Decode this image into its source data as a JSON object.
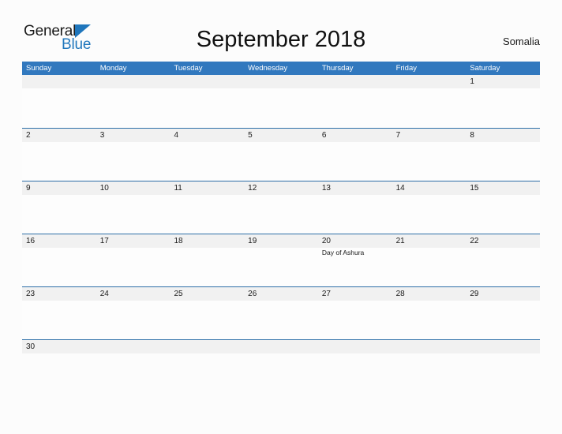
{
  "brand": {
    "name_part1": "General",
    "name_part2": "Blue",
    "triangle_color": "#1F76BC",
    "text_color_part1": "#1a1a1a",
    "text_color_part2": "#1F76BC"
  },
  "header": {
    "title": "September 2018",
    "month": "September",
    "year": "2018",
    "region": "Somalia"
  },
  "theme": {
    "header_bar_color": "#3178BE",
    "row_divider_color": "#2E6FA8",
    "date_band_color": "#f1f1f1",
    "page_background": "#fcfcfc",
    "text_color": "#1a1a1a"
  },
  "weekdays": [
    "Sunday",
    "Monday",
    "Tuesday",
    "Wednesday",
    "Thursday",
    "Friday",
    "Saturday"
  ],
  "weeks": [
    {
      "days": [
        {
          "num": "",
          "event": ""
        },
        {
          "num": "",
          "event": ""
        },
        {
          "num": "",
          "event": ""
        },
        {
          "num": "",
          "event": ""
        },
        {
          "num": "",
          "event": ""
        },
        {
          "num": "",
          "event": ""
        },
        {
          "num": "1",
          "event": ""
        }
      ]
    },
    {
      "days": [
        {
          "num": "2",
          "event": ""
        },
        {
          "num": "3",
          "event": ""
        },
        {
          "num": "4",
          "event": ""
        },
        {
          "num": "5",
          "event": ""
        },
        {
          "num": "6",
          "event": ""
        },
        {
          "num": "7",
          "event": ""
        },
        {
          "num": "8",
          "event": ""
        }
      ]
    },
    {
      "days": [
        {
          "num": "9",
          "event": ""
        },
        {
          "num": "10",
          "event": ""
        },
        {
          "num": "11",
          "event": ""
        },
        {
          "num": "12",
          "event": ""
        },
        {
          "num": "13",
          "event": ""
        },
        {
          "num": "14",
          "event": ""
        },
        {
          "num": "15",
          "event": ""
        }
      ]
    },
    {
      "days": [
        {
          "num": "16",
          "event": ""
        },
        {
          "num": "17",
          "event": ""
        },
        {
          "num": "18",
          "event": ""
        },
        {
          "num": "19",
          "event": ""
        },
        {
          "num": "20",
          "event": "Day of Ashura"
        },
        {
          "num": "21",
          "event": ""
        },
        {
          "num": "22",
          "event": ""
        }
      ]
    },
    {
      "days": [
        {
          "num": "23",
          "event": ""
        },
        {
          "num": "24",
          "event": ""
        },
        {
          "num": "25",
          "event": ""
        },
        {
          "num": "26",
          "event": ""
        },
        {
          "num": "27",
          "event": ""
        },
        {
          "num": "28",
          "event": ""
        },
        {
          "num": "29",
          "event": ""
        }
      ]
    },
    {
      "days": [
        {
          "num": "30",
          "event": ""
        },
        {
          "num": "",
          "event": ""
        },
        {
          "num": "",
          "event": ""
        },
        {
          "num": "",
          "event": ""
        },
        {
          "num": "",
          "event": ""
        },
        {
          "num": "",
          "event": ""
        },
        {
          "num": "",
          "event": ""
        }
      ]
    }
  ],
  "holidays": [
    {
      "date": "2018-09-20",
      "day": "20",
      "name": "Day of Ashura"
    }
  ]
}
